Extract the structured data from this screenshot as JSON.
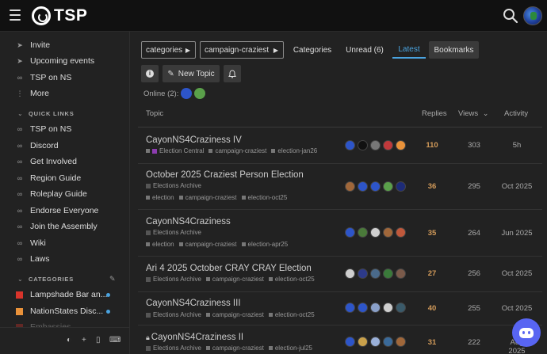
{
  "header": {
    "logo_text": "TSP",
    "menu_icon": "hamburger-icon",
    "search_icon": "search-icon"
  },
  "sidebar": {
    "top_items": [
      {
        "label": "Invite",
        "icon": "paper-plane-icon"
      },
      {
        "label": "Upcoming events",
        "icon": "paper-plane-icon"
      },
      {
        "label": "TSP on NS",
        "icon": "link-icon"
      },
      {
        "label": "More",
        "icon": "vertical-ellipsis-icon"
      }
    ],
    "quick_links_title": "QUICK LINKS",
    "quick_links": [
      {
        "label": "TSP on NS",
        "icon": "link-icon"
      },
      {
        "label": "Discord",
        "icon": "link-icon"
      },
      {
        "label": "Get Involved",
        "icon": "link-icon"
      },
      {
        "label": "Region Guide",
        "icon": "link-icon"
      },
      {
        "label": "Roleplay Guide",
        "icon": "link-icon"
      },
      {
        "label": "Endorse Everyone",
        "icon": "link-icon"
      },
      {
        "label": "Join the Assembly",
        "icon": "link-icon"
      },
      {
        "label": "Wiki",
        "icon": "link-icon"
      },
      {
        "label": "Laws",
        "icon": "link-icon"
      }
    ],
    "categories_title": "CATEGORIES",
    "categories": [
      {
        "label": "Lampshade Bar an...",
        "color": "#d9342b",
        "new": true
      },
      {
        "label": "NationStates Disc...",
        "color": "#e9923a",
        "new": true
      },
      {
        "label": "Embassies",
        "color": "#d9342b",
        "new": false
      }
    ],
    "footer_icons": [
      "theme-toggle-icon",
      "plus-icon",
      "mobile-icon",
      "keyboard-icon"
    ]
  },
  "nav": {
    "breadcrumb_category": "categories",
    "breadcrumb_tag": "campaign-craziest",
    "tabs": [
      {
        "label": "Categories"
      },
      {
        "label": "Unread (6)"
      },
      {
        "label": "Latest",
        "active": true
      },
      {
        "label": "Bookmarks"
      }
    ],
    "new_topic_label": "New Topic",
    "online_label": "Online (2):"
  },
  "table": {
    "headers": {
      "topic": "Topic",
      "replies": "Replies",
      "views": "Views",
      "activity": "Activity"
    },
    "rows": [
      {
        "title": "CayonNS4Craziness IV",
        "category": "Election Central",
        "category_color": "#8d3cb0",
        "tags": [
          "campaign-craziest",
          "election-jan26"
        ],
        "poster_colors": [
          "#2d55c9",
          "#111111",
          "#777777",
          "#c0393b",
          "#e9923a"
        ],
        "replies": "110",
        "views": "303",
        "activity": "5h"
      },
      {
        "title": "October 2025 Craziest Person Election",
        "category": "Elections Archive",
        "category_color": "#555555",
        "tags": [
          "election",
          "campaign-craziest",
          "election-oct25"
        ],
        "poster_colors": [
          "#a0673a",
          "#2d55c9",
          "#2d55c9",
          "#5aa04a",
          "#1d2b78"
        ],
        "replies": "36",
        "views": "295",
        "activity": "Oct 2025"
      },
      {
        "title": "CayonNS4Craziness",
        "category": "Elections Archive",
        "category_color": "#555555",
        "tags": [
          "election",
          "campaign-craziest",
          "election-apr25"
        ],
        "poster_colors": [
          "#2d55c9",
          "#4a7a3a",
          "#cfcfcf",
          "#a0673a",
          "#c0583b"
        ],
        "replies": "35",
        "views": "264",
        "activity": "Jun 2025"
      },
      {
        "title": "Ari 4 2025 October CRAY CRAY Election",
        "category": "Elections Archive",
        "category_color": "#555555",
        "tags": [
          "campaign-craziest",
          "election-oct25"
        ],
        "poster_colors": [
          "#cfcfcf",
          "#2d3a8a",
          "#4a6a8a",
          "#3a7a3a",
          "#7a5a4a"
        ],
        "replies": "27",
        "views": "256",
        "activity": "Oct 2025"
      },
      {
        "title": "CayonNS4Craziness III",
        "category": "Elections Archive",
        "category_color": "#555555",
        "tags": [
          "campaign-craziest",
          "election-oct25"
        ],
        "poster_colors": [
          "#2d55c9",
          "#2d55c9",
          "#8aa0c9",
          "#cfcfcf",
          "#3a5a6a"
        ],
        "replies": "40",
        "views": "255",
        "activity": "Oct 2025"
      },
      {
        "title": "CayonNS4Craziness II",
        "category": "Elections Archive",
        "category_color": "#555555",
        "tags": [
          "campaign-craziest",
          "election-jul25"
        ],
        "poster_colors": [
          "#2d55c9",
          "#c9a04a",
          "#9ab0d9",
          "#3a6a9a",
          "#a0673a"
        ],
        "replies": "31",
        "views": "222",
        "activity": "Aug 2025",
        "locked": true
      }
    ]
  }
}
